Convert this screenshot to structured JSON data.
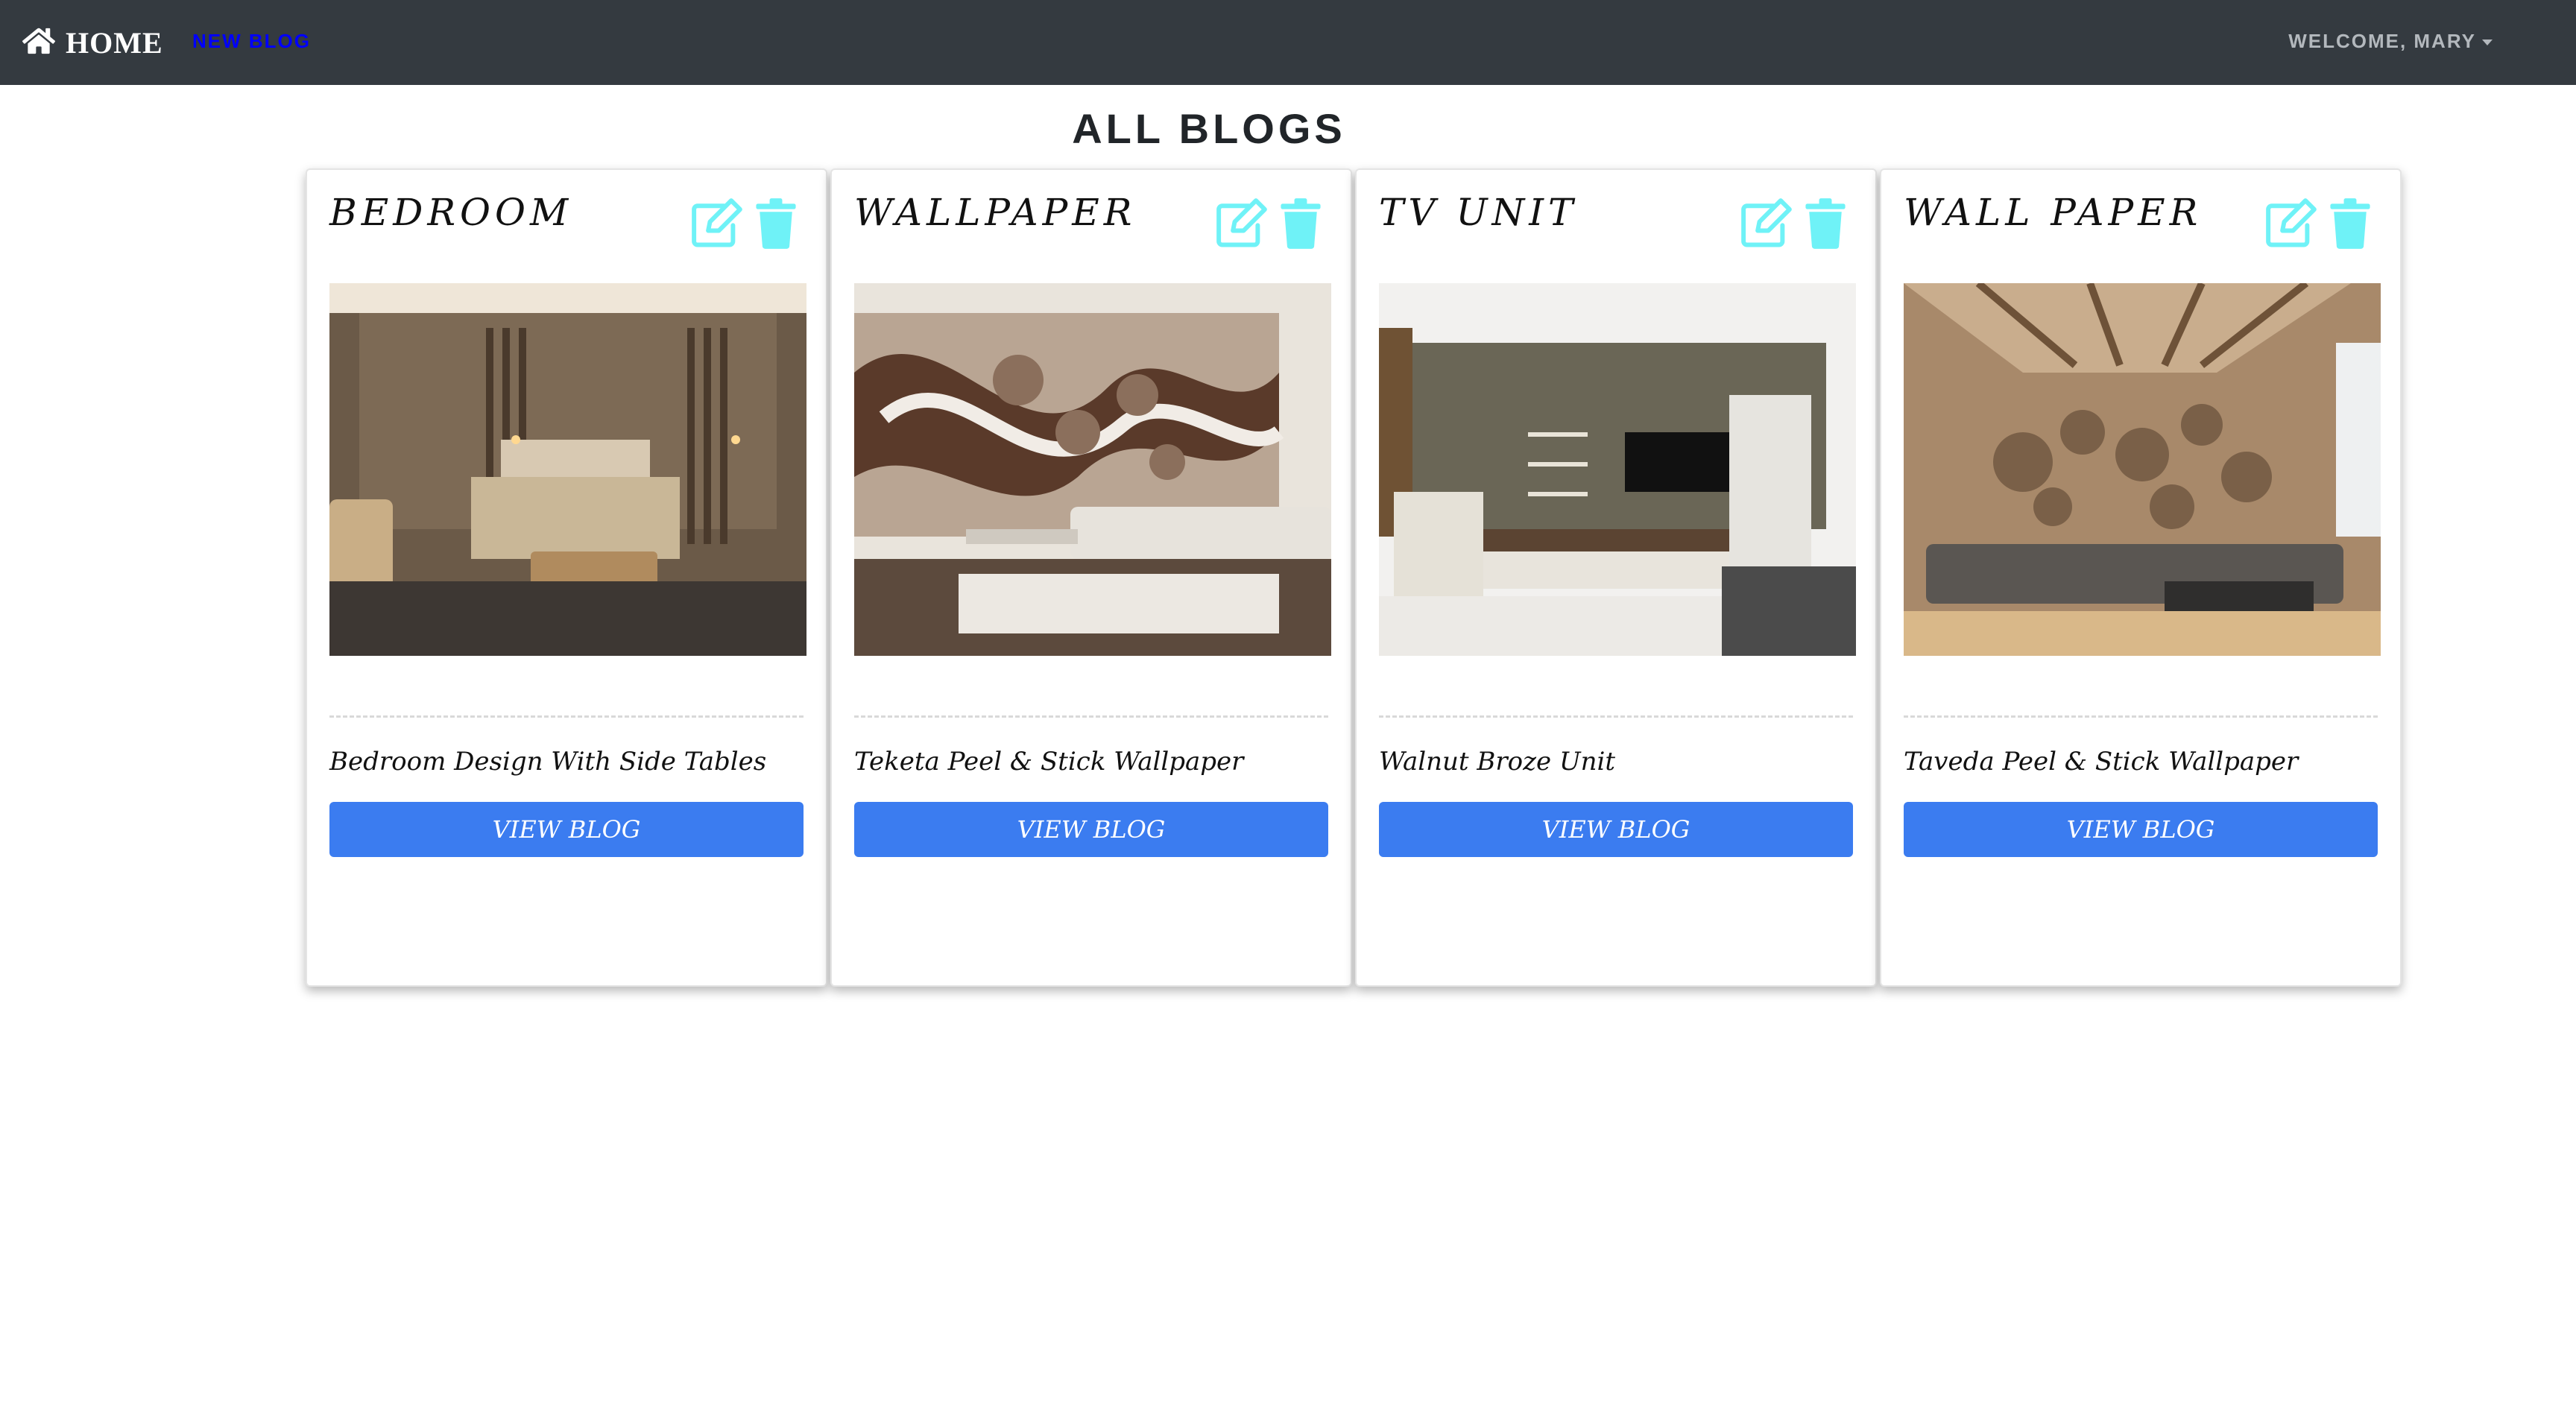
{
  "navbar": {
    "brand": "HOME",
    "new_blog": "NEW BLOG",
    "user_menu": "WELCOME, MARY"
  },
  "page": {
    "title": "ALL BLOGS"
  },
  "colors": {
    "navbar_bg": "#343a40",
    "icon_accent": "#6ff2f7",
    "button_bg": "#3b7cf0",
    "link_blue": "#0000ff"
  },
  "icons": {
    "home": "home-icon",
    "edit": "edit-icon",
    "delete": "trash-icon",
    "dropdown": "caret-down-icon"
  },
  "blogs": [
    {
      "title": "BEDROOM",
      "description": "Bedroom Design With Side Tables",
      "button": "VIEW BLOG"
    },
    {
      "title": "WALLPAPER",
      "description": "Teketa Peel & Stick Wallpaper",
      "button": "VIEW BLOG"
    },
    {
      "title": "TV UNIT",
      "description": "Walnut Broze Unit",
      "button": "VIEW BLOG"
    },
    {
      "title": "WALL PAPER",
      "description": "Taveda Peel & Stick Wallpaper",
      "button": "VIEW BLOG"
    }
  ]
}
